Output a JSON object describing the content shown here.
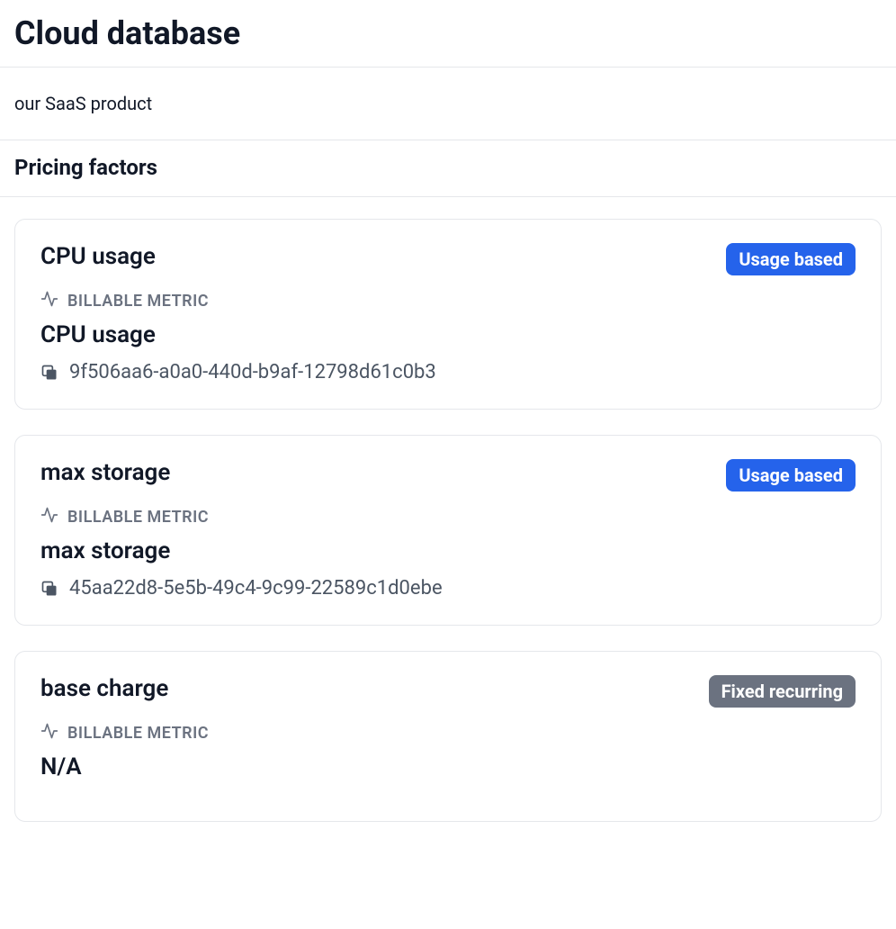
{
  "page": {
    "title": "Cloud database",
    "description": "our SaaS product",
    "section_title": "Pricing factors"
  },
  "labels": {
    "billable_metric": "BILLABLE METRIC"
  },
  "factors": [
    {
      "title": "CPU usage",
      "badge": "Usage based",
      "badge_type": "blue",
      "metric_name": "CPU usage",
      "metric_id": "9f506aa6-a0a0-440d-b9af-12798d61c0b3"
    },
    {
      "title": "max storage",
      "badge": "Usage based",
      "badge_type": "blue",
      "metric_name": "max storage",
      "metric_id": "45aa22d8-5e5b-49c4-9c99-22589c1d0ebe"
    },
    {
      "title": "base charge",
      "badge": "Fixed recurring",
      "badge_type": "gray",
      "metric_name": "N/A",
      "metric_id": null
    }
  ]
}
